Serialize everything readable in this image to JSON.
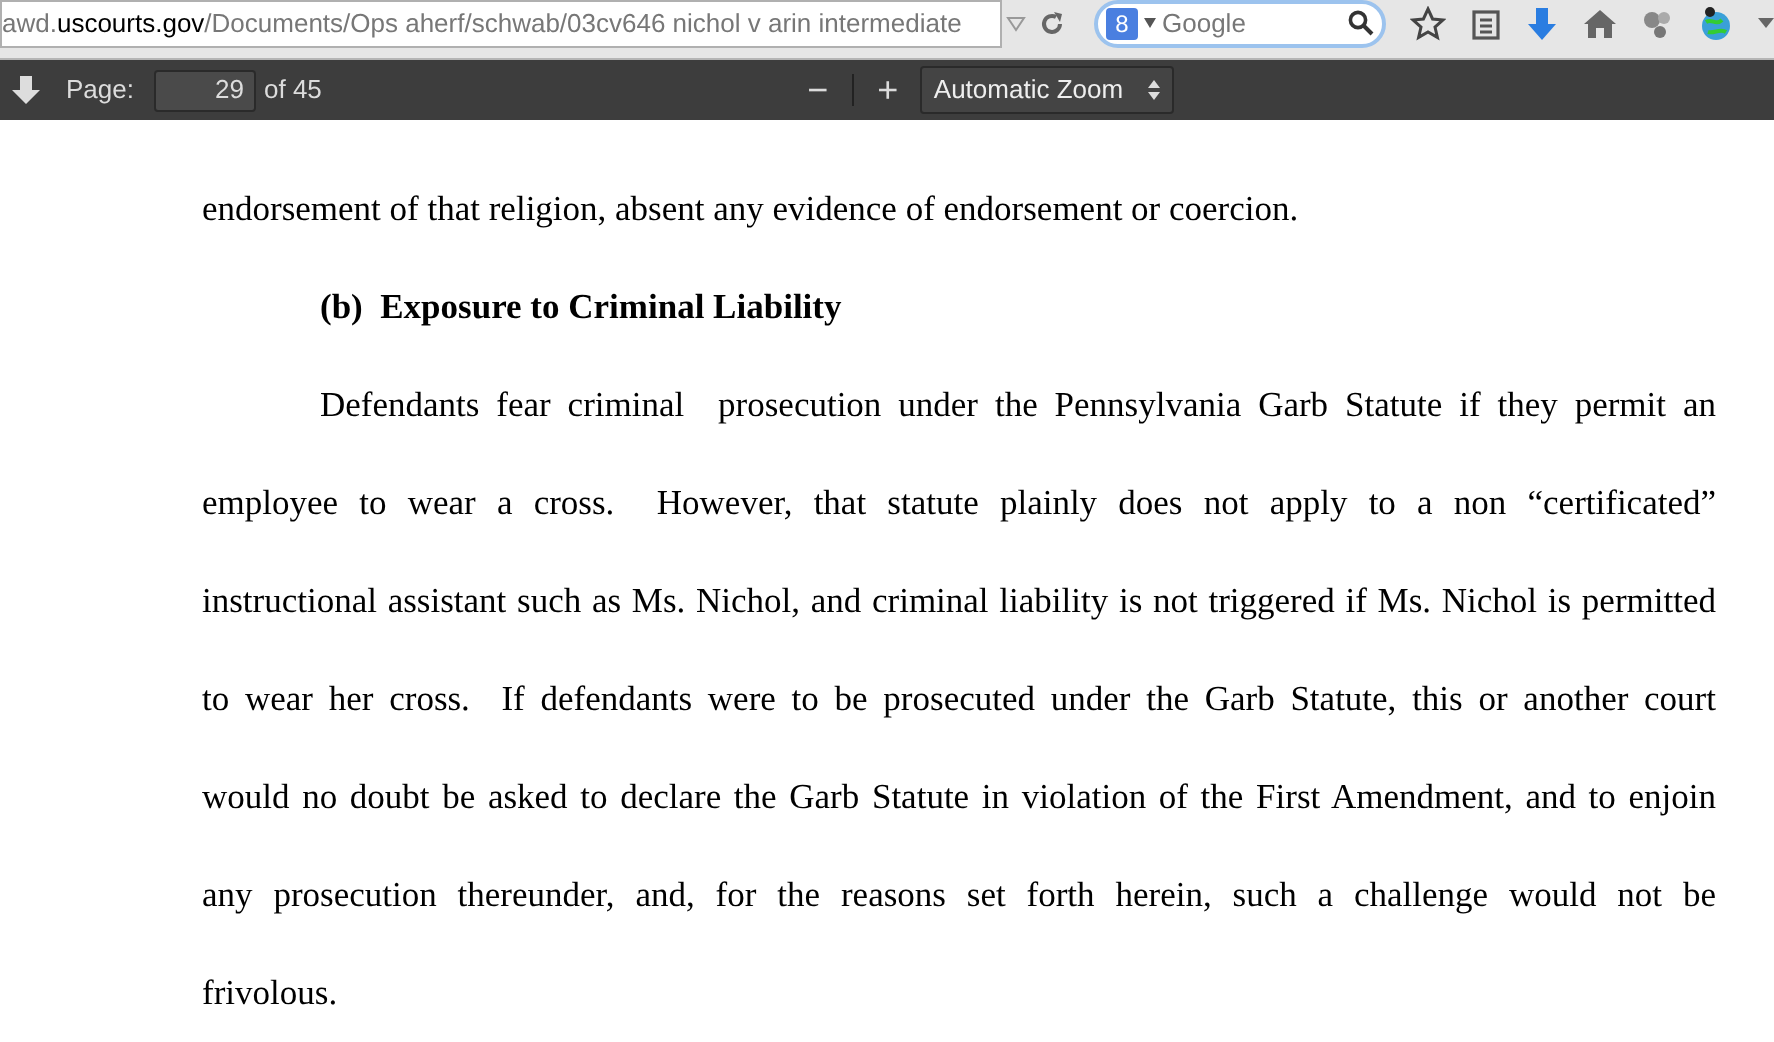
{
  "address_bar": {
    "url_prefix": "awd.",
    "url_domain": "uscourts.gov",
    "url_path": "/Documents/Ops aherf/schwab/03cv646 nichol v arin intermediate"
  },
  "search": {
    "placeholder": "Google",
    "engine_icon": "8"
  },
  "pdf_toolbar": {
    "page_label": "Page:",
    "page_value": "29",
    "page_total": "of 45",
    "zoom_out": "−",
    "zoom_in": "+",
    "zoom": "Automatic Zoom"
  },
  "document": [
    {
      "kind": "paragraph",
      "indent": false,
      "lines": [
        "endorsement of that religion, absent any evidence of endorsement or coercion."
      ]
    },
    {
      "kind": "heading",
      "lines": [
        "(b)  Exposure to Criminal Liability"
      ]
    },
    {
      "kind": "paragraph",
      "indent": true,
      "lines": [
        "Defendants fear criminal  prosecution under the Pennsylvania Garb Statute if they permit an",
        "employee to wear a cross.  However, that statute plainly does not apply to a non “certificated”",
        "instructional assistant such as Ms. Nichol, and criminal liability is not triggered if Ms. Nichol is permitted",
        "to wear her cross.  If defendants were to be prosecuted under the Garb Statute, this or another court",
        "would no doubt be asked to declare the Garb Statute in violation of the First Amendment, and to enjoin",
        "any prosecution thereunder, and, for the reasons set forth herein, such a challenge would not be",
        "frivolous."
      ]
    }
  ]
}
